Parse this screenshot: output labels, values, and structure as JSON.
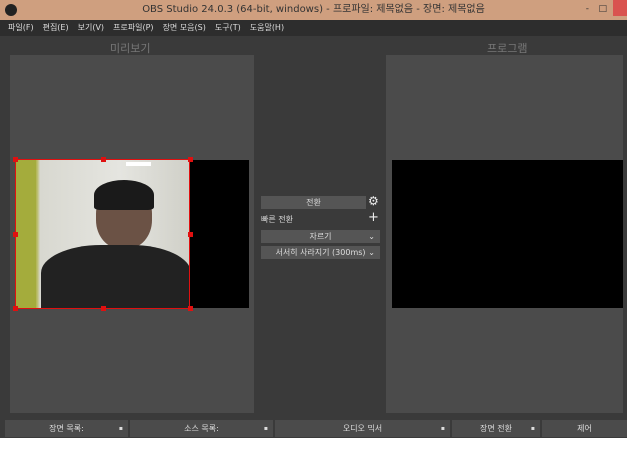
{
  "window": {
    "title": "OBS Studio 24.0.3 (64-bit, windows) - 프로파일: 제목없음 - 장면: 제목없음",
    "minimize": "-",
    "maximize": "□",
    "close": "x"
  },
  "menu": [
    "파일(F)",
    "편집(E)",
    "보기(V)",
    "프로파일(P)",
    "장면 모음(S)",
    "도구(T)",
    "도움말(H)"
  ],
  "preview": {
    "label": "미리보기"
  },
  "program": {
    "label": "프로그램"
  },
  "transition": {
    "button": "전환",
    "quick": "빠른 전환",
    "type": "자르기",
    "fade": "서서히 사라지기 (300ms)"
  },
  "docks": [
    {
      "label": "장면 목록:"
    },
    {
      "label": "소스 목록:"
    },
    {
      "label": "오디오 믹서"
    },
    {
      "label": "장면 전환"
    },
    {
      "label": "제어"
    }
  ],
  "colors": {
    "titlebar": "#cf9f7f",
    "selection": "#e01010"
  }
}
